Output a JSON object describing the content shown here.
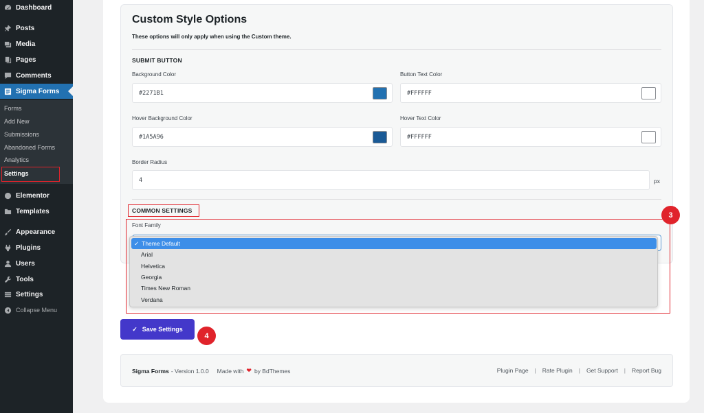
{
  "sidebar": {
    "menu": [
      {
        "label": "Dashboard",
        "icon": "dashboard-icon"
      },
      {
        "label": "Posts",
        "icon": "pin-icon"
      },
      {
        "label": "Media",
        "icon": "media-icon"
      },
      {
        "label": "Pages",
        "icon": "pages-icon"
      },
      {
        "label": "Comments",
        "icon": "comment-icon"
      },
      {
        "label": "Sigma Forms",
        "icon": "forms-icon"
      }
    ],
    "submenu": [
      "Forms",
      "Add New",
      "Submissions",
      "Abandoned Forms",
      "Analytics",
      "Settings"
    ],
    "menu2": [
      {
        "label": "Elementor",
        "icon": "elementor-icon"
      },
      {
        "label": "Templates",
        "icon": "folder-icon"
      },
      {
        "label": "Appearance",
        "icon": "brush-icon"
      },
      {
        "label": "Plugins",
        "icon": "plugin-icon"
      },
      {
        "label": "Users",
        "icon": "user-icon"
      },
      {
        "label": "Tools",
        "icon": "wrench-icon"
      },
      {
        "label": "Settings",
        "icon": "settings-icon"
      },
      {
        "label": "Collapse Menu",
        "icon": "collapse-icon"
      }
    ]
  },
  "panel": {
    "title": "Custom Style Options",
    "description": "These options will only apply when using the Custom theme.",
    "submit_section": "SUBMIT BUTTON",
    "fields": {
      "bg_color_label": "Background Color",
      "bg_color_value": "#2271B1",
      "text_color_label": "Button Text Color",
      "text_color_value": "#FFFFFF",
      "hover_bg_label": "Hover Background Color",
      "hover_bg_value": "#1A5A96",
      "hover_text_label": "Hover Text Color",
      "hover_text_value": "#FFFFFF",
      "radius_label": "Border Radius",
      "radius_value": "4",
      "radius_unit": "px"
    },
    "common_section": "COMMON SETTINGS",
    "font_family_label": "Font Family",
    "font_options": [
      "Theme Default",
      "Arial",
      "Helvetica",
      "Georgia",
      "Times New Roman",
      "Verdana"
    ],
    "selected_font": "Theme Default"
  },
  "badges": {
    "step3": "3",
    "step4": "4"
  },
  "save_label": "Save Settings",
  "footer": {
    "brand": "Sigma Forms",
    "version": "- Version 1.0.0",
    "made_with": "Made with",
    "by": "by BdThemes",
    "links": [
      "Plugin Page",
      "Rate Plugin",
      "Get Support",
      "Report Bug"
    ]
  },
  "colors": {
    "accent": "#2271B1",
    "hover_bg": "#1A5A96",
    "white": "#FFFFFF",
    "sidebar_bg": "#1d2327",
    "annotation_red": "#e0232b",
    "save_button": "#4338ca"
  }
}
